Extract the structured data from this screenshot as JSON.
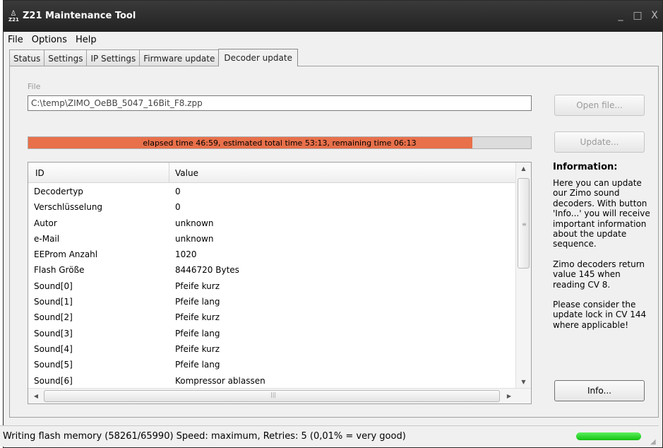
{
  "window": {
    "title": "Z21 Maintenance Tool",
    "icon_label": "Z21",
    "controls": [
      "_",
      "□",
      "X"
    ]
  },
  "menu": [
    "File",
    "Options",
    "Help"
  ],
  "tabs": [
    "Status",
    "Settings",
    "IP Settings",
    "Firmware update",
    "Decoder update"
  ],
  "active_tab": "Decoder update",
  "file": {
    "label": "File",
    "value": "C:\\temp\\ZIMO_OeBB_5047_16Bit_F8.zpp"
  },
  "buttons": {
    "open_file": "Open file...",
    "update": "Update...",
    "info": "Info..."
  },
  "progress": {
    "text": "elapsed time 46:59, estimated total time 53:13, remaining time 06:13",
    "fraction": 0.883,
    "color": "#e8704a"
  },
  "table": {
    "headers": [
      "ID",
      "Value"
    ],
    "rows": [
      [
        "Decodertyp",
        "0"
      ],
      [
        "Verschlüsselung",
        "0"
      ],
      [
        "Autor",
        "unknown"
      ],
      [
        "e-Mail",
        "unknown"
      ],
      [
        "EEProm Anzahl",
        "1020"
      ],
      [
        "Flash Größe",
        "8446720 Bytes"
      ],
      [
        "Sound[0]",
        "Pfeife kurz"
      ],
      [
        "Sound[1]",
        "Pfeife lang"
      ],
      [
        "Sound[2]",
        "Pfeife kurz"
      ],
      [
        "Sound[3]",
        "Pfeife lang"
      ],
      [
        "Sound[4]",
        "Pfeife kurz"
      ],
      [
        "Sound[5]",
        "Pfeife lang"
      ],
      [
        "Sound[6]",
        "Kompressor ablassen"
      ]
    ]
  },
  "info": {
    "title": "Information:",
    "paragraphs": [
      "Here you can update our Zimo sound decoders. With button 'Info...' you will receive important information about the update sequence.",
      "Zimo decoders return value 145 when reading CV 8.",
      "Please consider the update lock in CV 144 where applicable!"
    ]
  },
  "status": {
    "text": "Writing flash memory (58261/65990) Speed: maximum, Retries: 5 (0,01% = very good)",
    "indicator_color": "#22cc22"
  }
}
